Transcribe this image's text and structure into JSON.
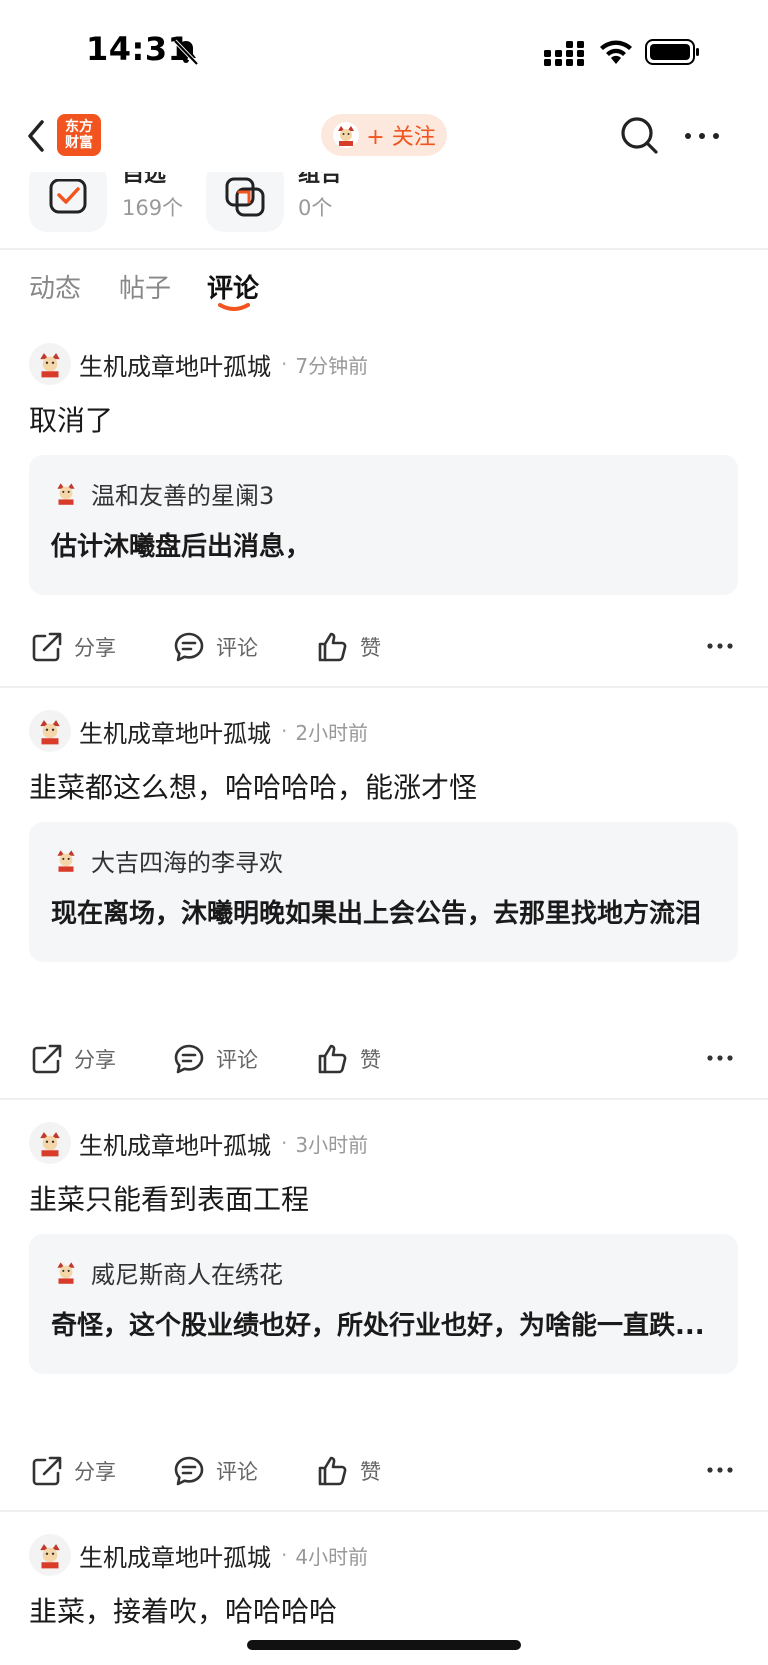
{
  "status": {
    "time": "14:31"
  },
  "nav": {
    "logo_line1": "东方",
    "logo_line2": "财富",
    "follow_label": "+ 关注"
  },
  "stats": [
    {
      "title": "自选",
      "count": "169个"
    },
    {
      "title": "组合",
      "count": "0个"
    }
  ],
  "tabs": [
    {
      "label": "动态"
    },
    {
      "label": "帖子"
    },
    {
      "label": "评论",
      "active": true
    }
  ],
  "actions": {
    "share": "分享",
    "comment": "评论",
    "like": "赞"
  },
  "comments": [
    {
      "user": "生机成章地叶孤城",
      "time": "7分钟前",
      "text": "取消了",
      "quote_user": "温和友善的星阑3",
      "quote_text": "估计沐曦盘后出消息，"
    },
    {
      "user": "生机成章地叶孤城",
      "time": "2小时前",
      "text": "韭菜都这么想，哈哈哈哈，能涨才怪",
      "quote_user": "大吉四海的李寻欢",
      "quote_text": "现在离场，沐曦明晚如果出上会公告，去那里找地方流泪"
    },
    {
      "user": "生机成章地叶孤城",
      "time": "3小时前",
      "text": "韭菜只能看到表面工程",
      "quote_user": "威尼斯商人在绣花",
      "quote_text": "奇怪，这个股业绩也好，所处行业也好，为啥能一直跌..."
    },
    {
      "user": "生机成章地叶孤城",
      "time": "4小时前",
      "text": "韭菜，接着吹，哈哈哈哈"
    }
  ],
  "colors": {
    "brand": "#f2541f",
    "follow_bg": "#fde8de",
    "quote_bg": "#f5f6f8"
  }
}
